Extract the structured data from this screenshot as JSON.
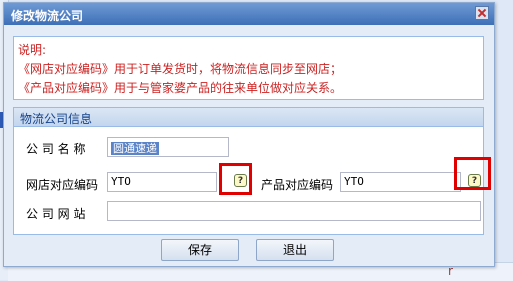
{
  "dialog": {
    "title": "修改物流公司"
  },
  "notice": {
    "heading": "说明:",
    "line1": "《网店对应编码》用于订单发货时，将物流信息同步至网店；",
    "line2": "《产品对应编码》用于与管家婆产品的往来单位做对应关系。"
  },
  "panel": {
    "title": "物流公司信息"
  },
  "form": {
    "company_name_label": "公 司 名 称",
    "company_name_value": "圆通速递",
    "shop_code_label": "网店对应编码",
    "shop_code_value": "YTO",
    "product_code_label": "产品对应编码",
    "product_code_value": "YTO",
    "website_label": "公 司 网 站",
    "website_value": "",
    "help_glyph": "?"
  },
  "buttons": {
    "save": "保存",
    "exit": "退出"
  },
  "backdrop": {
    "mark": "r"
  }
}
